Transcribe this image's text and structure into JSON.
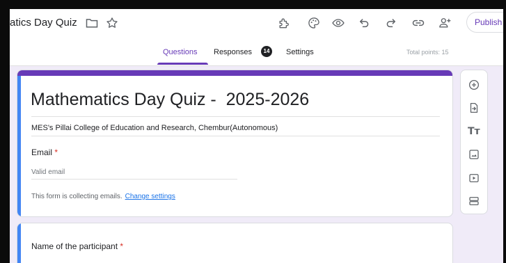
{
  "header": {
    "title": "atics Day Quiz",
    "publish_label": "Publish"
  },
  "tabs": [
    {
      "label": "Questions",
      "active": true
    },
    {
      "label": "Responses",
      "badge": "14"
    },
    {
      "label": "Settings"
    }
  ],
  "total_points": "Total points: 15",
  "form": {
    "title": "Mathematics Day Quiz -  2025-2026",
    "description": "MES's Pillai College of Education and Research, Chembur(Autonomous)",
    "email_label": "Email",
    "required_mark": "*",
    "email_placeholder": "Valid email",
    "collecting_text": "This form is collecting emails.",
    "change_settings_link": "Change settings"
  },
  "questions": [
    {
      "label": "Name of the participant",
      "required_mark": "*"
    }
  ],
  "colors": {
    "accent": "#673ab7",
    "focus_strip": "#4285f4",
    "background": "#f0ebf8",
    "required": "#d93025",
    "link": "#1a73e8"
  },
  "icons": {
    "header": [
      "folder-icon",
      "star-icon",
      "customize-addons-icon",
      "palette-icon",
      "preview-eye-icon",
      "undo-icon",
      "redo-icon",
      "link-icon",
      "add-collaborator-icon"
    ],
    "side_toolbar": [
      "add-question-icon",
      "import-questions-icon",
      "add-title-icon",
      "add-image-icon",
      "add-video-icon",
      "add-section-icon"
    ]
  }
}
